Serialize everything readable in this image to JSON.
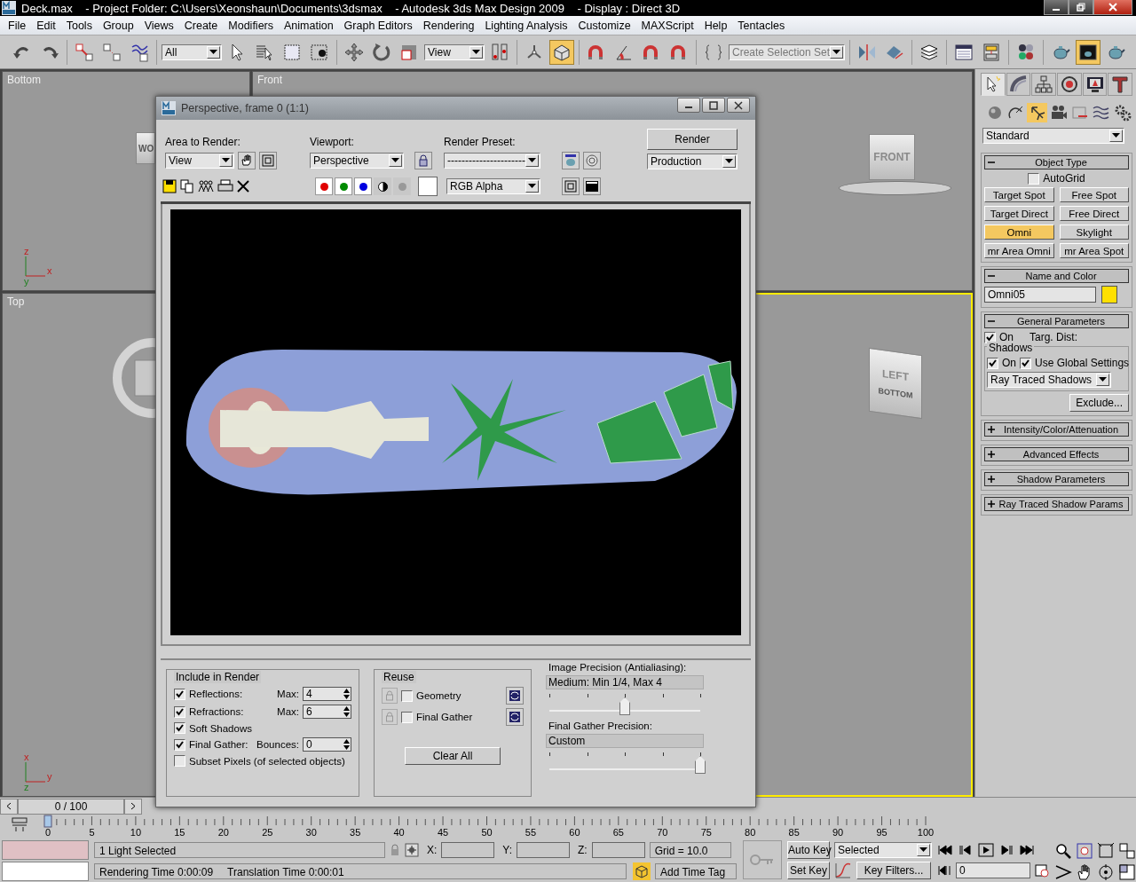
{
  "window": {
    "title": "Deck.max    - Project Folder: C:\\Users\\Xeonshaun\\Documents\\3dsmax    - Autodesk 3ds Max Design 2009    - Display : Direct 3D"
  },
  "menu": [
    "File",
    "Edit",
    "Tools",
    "Group",
    "Views",
    "Create",
    "Modifiers",
    "Animation",
    "Graph Editors",
    "Rendering",
    "Lighting Analysis",
    "Customize",
    "MAXScript",
    "Help",
    "Tentacles"
  ],
  "toolbar": {
    "groups": [
      [
        {
          "kind": "undo",
          "selected": false
        },
        {
          "kind": "redo",
          "selected": false
        }
      ],
      [
        {
          "kind": "link",
          "selected": false
        },
        {
          "kind": "unlink",
          "selected": false
        },
        {
          "kind": "bind",
          "selected": false
        }
      ],
      [
        {
          "kind": "dropdown",
          "value": "All"
        },
        {
          "kind": "select",
          "selected": false
        },
        {
          "kind": "select_by_name",
          "selected": false
        },
        {
          "kind": "rect_region",
          "selected": false
        },
        {
          "kind": "window_crossing",
          "selected": false
        }
      ],
      [
        {
          "kind": "move",
          "selected": false
        },
        {
          "kind": "rotate",
          "selected": false
        },
        {
          "kind": "scale",
          "selected": false
        },
        {
          "kind": "dropdown",
          "value": "View"
        },
        {
          "kind": "pivot",
          "selected": false
        }
      ],
      [
        {
          "kind": "manipulate",
          "selected": false
        },
        {
          "kind": "place",
          "selected": true
        }
      ],
      [
        {
          "kind": "snap",
          "selected": false
        },
        {
          "kind": "angle_snap",
          "selected": false
        },
        {
          "kind": "percent_snap",
          "selected": false
        },
        {
          "kind": "spinner_snap",
          "selected": false
        }
      ],
      [
        {
          "kind": "named_sets",
          "selected": false
        },
        {
          "kind": "dropdown",
          "placeholder": "Create Selection Set"
        }
      ],
      [
        {
          "kind": "mirror",
          "selected": false
        },
        {
          "kind": "align",
          "selected": false
        }
      ],
      [
        {
          "kind": "layers",
          "selected": false
        }
      ],
      [
        {
          "kind": "curve",
          "selected": false
        },
        {
          "kind": "schematic",
          "selected": false
        }
      ],
      [
        {
          "kind": "material",
          "selected": false
        }
      ],
      [
        {
          "kind": "render_setup",
          "selected": false
        },
        {
          "kind": "render_frame",
          "selected": true
        },
        {
          "kind": "quick_render",
          "selected": false
        }
      ]
    ]
  },
  "viewports": [
    {
      "label": "Bottom",
      "active": false,
      "cube": {
        "kind": "box",
        "label": "WO"
      },
      "axes": [
        "z",
        "x",
        "y"
      ]
    },
    {
      "label": "Front",
      "active": false,
      "cube": {
        "kind": "box",
        "label": "FRONT"
      }
    },
    {
      "label": "Top",
      "active": false,
      "cube": {
        "kind": "ring"
      },
      "axes": [
        "x",
        "y",
        "z"
      ]
    },
    {
      "active": true,
      "cube": {
        "kind": "box",
        "label": "LEFT",
        "side_label": "BOTTOM"
      }
    }
  ],
  "render_window": {
    "title": "Perspective, frame 0 (1:1)",
    "area_label": "Area to Render:",
    "area": "View",
    "viewport_label": "Viewport:",
    "viewport": "Perspective",
    "preset_label": "Render Preset:",
    "preset": "----------------------",
    "render_button": "Render",
    "mode": "Production",
    "channels": [
      {
        "kind": "red",
        "on": true
      },
      {
        "kind": "green",
        "on": true
      },
      {
        "kind": "blue",
        "on": true
      },
      {
        "kind": "mono",
        "on": false
      },
      {
        "kind": "alpha",
        "on": false
      }
    ],
    "channel_display": "RGB Alpha",
    "include": {
      "title": "Include in Render",
      "options": [
        {
          "label": "Reflections:",
          "checked": true,
          "field_label": "Max:",
          "value": "4"
        },
        {
          "label": "Refractions:",
          "checked": true,
          "field_label": "Max:",
          "value": "6"
        },
        {
          "label": "Soft Shadows",
          "checked": true
        },
        {
          "label": "Final Gather:",
          "checked": true,
          "field_label": "Bounces:",
          "value": "0"
        },
        {
          "label": "Subset Pixels (of selected objects)",
          "checked": false
        }
      ]
    },
    "reuse": {
      "title": "Reuse",
      "options": [
        {
          "label": "Geometry",
          "checked": false
        },
        {
          "label": "Final Gather",
          "checked": false
        }
      ],
      "clear_button": "Clear All"
    },
    "image_precision": {
      "label": "Image Precision (Antialiasing):",
      "value": "Medium: Min 1/4, Max 4",
      "level": 0.5
    },
    "fg_precision": {
      "label": "Final Gather Precision:",
      "value": "Custom",
      "level": 1
    }
  },
  "command_panel": {
    "tabs": [
      {
        "kind": "create",
        "selected": true
      },
      {
        "kind": "modify",
        "selected": false
      },
      {
        "kind": "hierarchy",
        "selected": false
      },
      {
        "kind": "motion",
        "selected": false
      },
      {
        "kind": "display",
        "selected": false
      },
      {
        "kind": "utilities",
        "selected": false
      }
    ],
    "categories": [
      {
        "kind": "geometry",
        "selected": false
      },
      {
        "kind": "shapes",
        "selected": false
      },
      {
        "kind": "lights",
        "selected": true
      },
      {
        "kind": "cameras",
        "selected": false
      },
      {
        "kind": "helpers",
        "selected": false
      },
      {
        "kind": "space_warps",
        "selected": false
      },
      {
        "kind": "systems",
        "selected": false
      }
    ],
    "type": "Standard",
    "object_type": {
      "title": "Object Type",
      "expanded": true,
      "autogrid": {
        "label": "AutoGrid",
        "checked": false
      },
      "buttons": [
        {
          "label": "Target Spot",
          "selected": false
        },
        {
          "label": "Free Spot",
          "selected": false
        },
        {
          "label": "Target Direct",
          "selected": false
        },
        {
          "label": "Free Direct",
          "selected": false
        },
        {
          "label": "Omni",
          "selected": true
        },
        {
          "label": "Skylight",
          "selected": false
        },
        {
          "label": "mr Area Omni",
          "selected": false
        },
        {
          "label": "mr Area Spot",
          "selected": false
        }
      ]
    },
    "name_color": {
      "title": "Name and Color",
      "expanded": true,
      "name": "Omni05",
      "color": "#ffe000"
    },
    "general": {
      "title": "General Parameters",
      "expanded": true,
      "light_on": {
        "label": "On",
        "checked": true
      },
      "targ_dist": "Targ. Dist:",
      "shadows_title": "Shadows",
      "shadow_on": {
        "label": "On",
        "checked": true
      },
      "global": {
        "label": "Use Global Settings",
        "checked": true
      },
      "shadow_type": "Ray Traced Shadows",
      "exclude": "Exclude..."
    },
    "collapsed": [
      {
        "title": "Intensity/Color/Attenuation",
        "expanded": false
      },
      {
        "title": "Advanced Effects",
        "expanded": false
      },
      {
        "title": "Shadow Parameters",
        "expanded": false
      },
      {
        "title": "Ray Traced Shadow Params",
        "expanded": false
      }
    ]
  },
  "time_slider": {
    "value": "0 / 100",
    "level": 0
  },
  "ruler": [
    "0",
    "5",
    "10",
    "15",
    "20",
    "25",
    "30",
    "35",
    "40",
    "45",
    "50",
    "55",
    "60",
    "65",
    "70",
    "75",
    "80",
    "85",
    "90",
    "95",
    "100"
  ],
  "status": {
    "selection": "1 Light Selected",
    "rendering_time": "Rendering Time  0:00:09",
    "translation_time": "Translation Time  0:00:01",
    "coords": [
      "X:",
      "Y:",
      "Z:"
    ],
    "grid": "Grid = 10.0",
    "add_time_tag": "Add Time Tag",
    "auto_key": {
      "label": "Auto Key",
      "on": false
    },
    "key_mode": "Selected",
    "set_key": "Set Key",
    "key_filters": "Key Filters...",
    "frame": "0"
  }
}
